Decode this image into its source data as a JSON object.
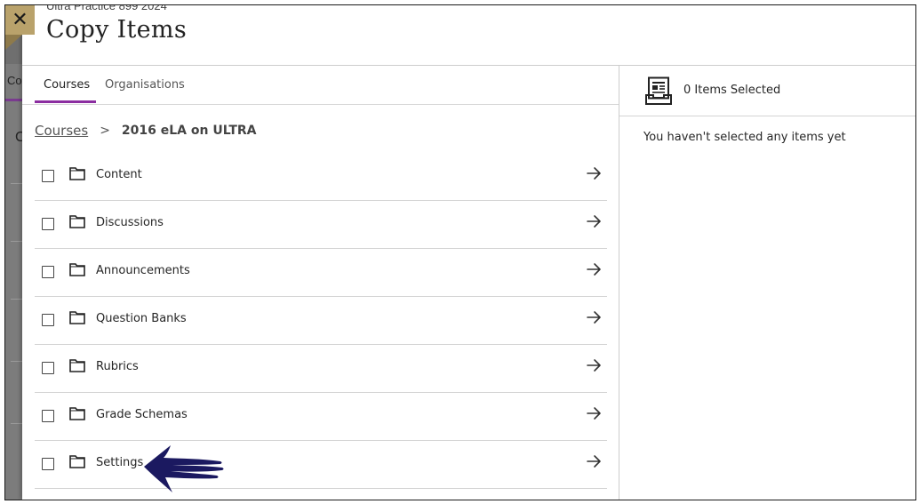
{
  "dialog": {
    "course_label": "Ultra Practice 899 2024",
    "title": "Copy Items",
    "close_icon": "close-icon"
  },
  "background_page": {
    "tab_fragment": "Co",
    "heading_fragment": "C"
  },
  "tabs": [
    {
      "label": "Courses",
      "active": true
    },
    {
      "label": "Organisations",
      "active": false
    }
  ],
  "breadcrumb": {
    "root": "Courses",
    "separator": ">",
    "current": "2016 eLA on ULTRA"
  },
  "items": [
    {
      "label": "Content",
      "icon": "folder-icon"
    },
    {
      "label": "Discussions",
      "icon": "folder-icon"
    },
    {
      "label": "Announcements",
      "icon": "folder-icon"
    },
    {
      "label": "Question Banks",
      "icon": "folder-icon"
    },
    {
      "label": "Rubrics",
      "icon": "folder-icon"
    },
    {
      "label": "Grade Schemas",
      "icon": "folder-icon"
    },
    {
      "label": "Settings",
      "icon": "folder-icon"
    }
  ],
  "selection": {
    "count_label": "0 Items Selected",
    "empty_message": "You haven't selected any items yet",
    "icon": "inbox-tray-icon"
  },
  "colors": {
    "accent_tab": "#8b2da0",
    "close_bg": "#b9a26b",
    "annotation_arrow": "#1b1960"
  }
}
